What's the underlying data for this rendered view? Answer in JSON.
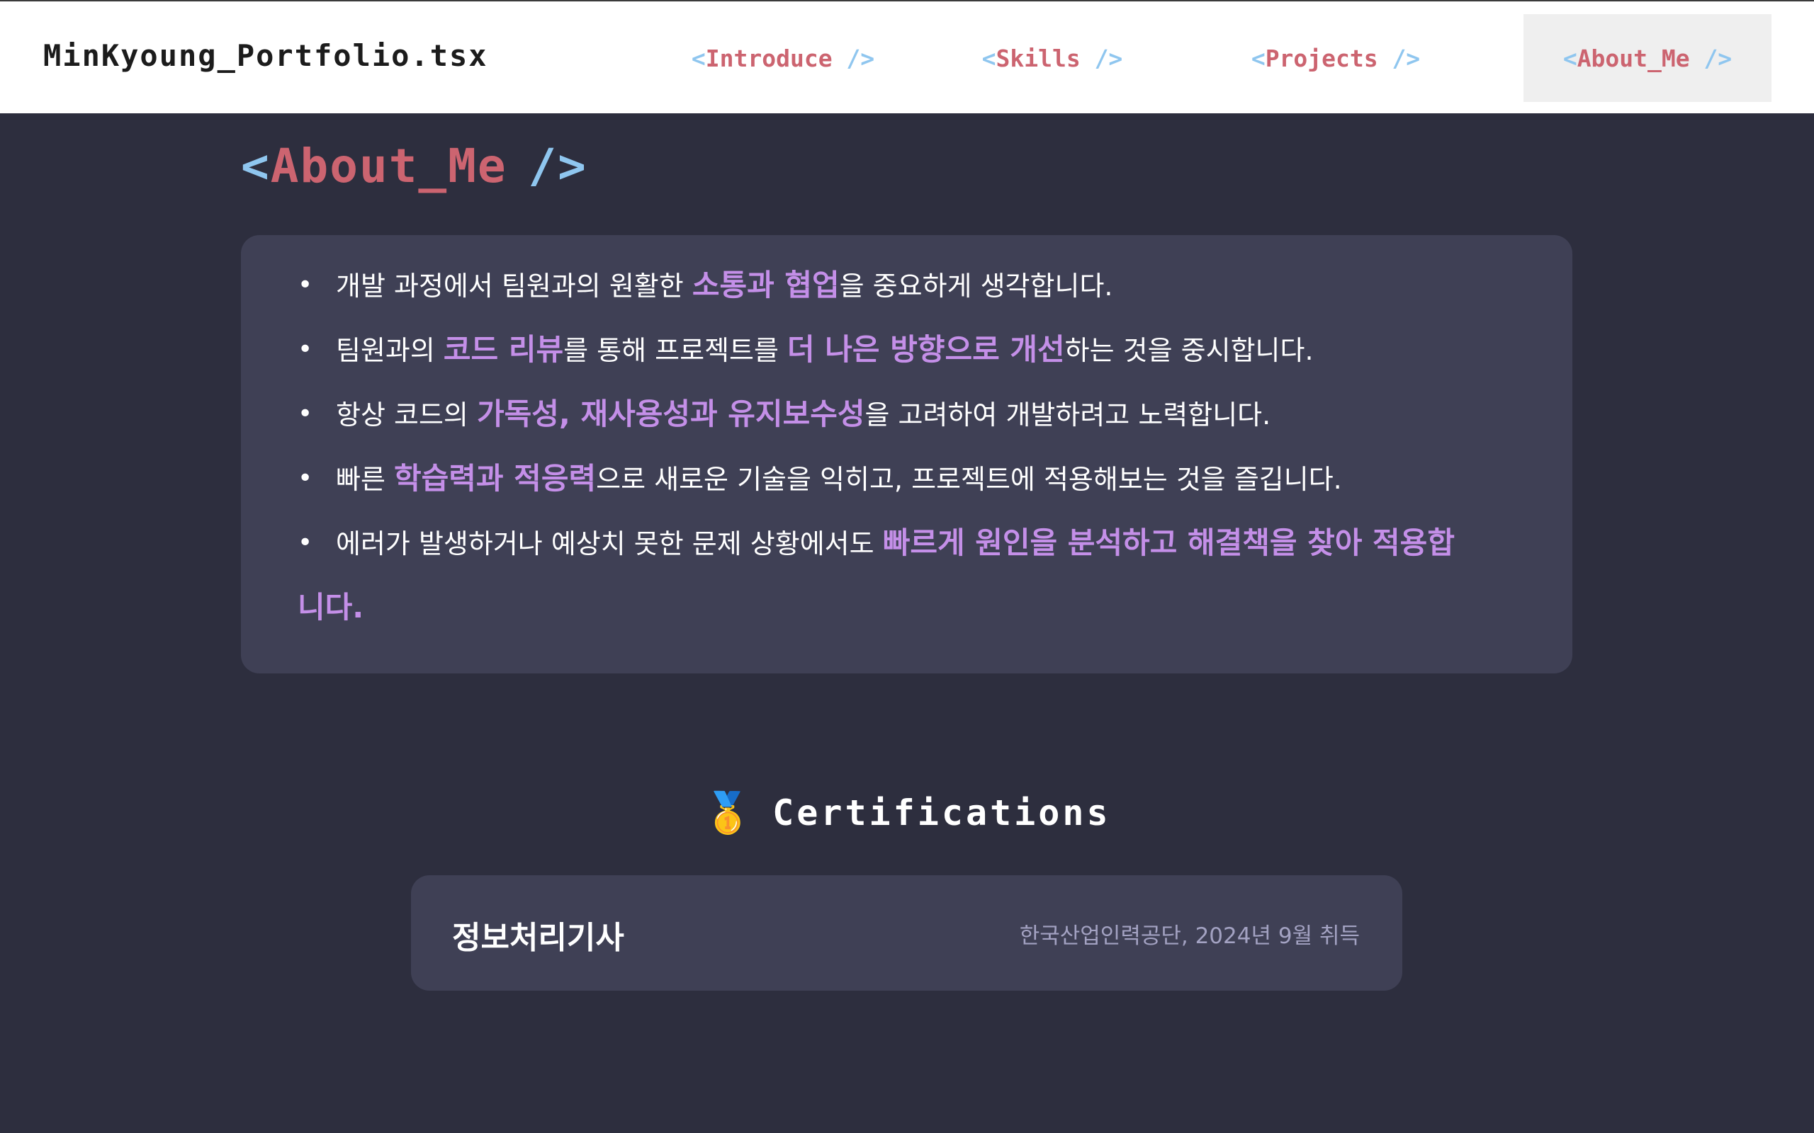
{
  "header": {
    "brand": "MinKyoung_Portfolio.tsx",
    "nav": [
      {
        "lt": "<",
        "name": "Introduce",
        "slash": "/>"
      },
      {
        "lt": "<",
        "name": "Skills",
        "slash": "/>"
      },
      {
        "lt": "<",
        "name": "Projects",
        "slash": "/>"
      },
      {
        "lt": "<",
        "name": "About_Me",
        "slash": "/>",
        "active": true
      }
    ]
  },
  "section": {
    "lt": "<",
    "name": "About_Me",
    "slash": "/>"
  },
  "about": {
    "bullet": "•",
    "items": [
      {
        "pre": "개발 과정에서 팀원과의 원활한 ",
        "hl": "소통과 협업",
        "post": "을 중요하게 생각합니다."
      },
      {
        "pre": "팀원과의 ",
        "hl": "코드 리뷰",
        "mid": "를 통해 프로젝트를 ",
        "hl2": "더 나은 방향으로 개선",
        "post": "하는 것을 중시합니다."
      },
      {
        "pre": "항상 코드의 ",
        "hl": "가독성, 재사용성과 유지보수성",
        "post": "을 고려하여 개발하려고 노력합니다."
      },
      {
        "pre": "빠른 ",
        "hl": "학습력과 적응력",
        "post": "으로 새로운 기술을 익히고, 프로젝트에 적용해보는 것을 즐깁니다."
      },
      {
        "pre": "에러가 발생하거나 예상치 못한 문제 상황에서도 ",
        "hl": "빠르게 원인을 분석하고 해결책을 찾아 적용합",
        "hl_cont": "니다."
      }
    ]
  },
  "certifications": {
    "icon": "medal-icon",
    "medal_glyph": "🥇",
    "title": "Certifications",
    "items": [
      {
        "name": "정보처리기사",
        "meta": "한국산업인력공단, 2024년 9월 취득"
      }
    ]
  },
  "colors": {
    "background": "#2d2e3e",
    "card": "#3f4055",
    "accent_purple": "#c48fe8",
    "tag_red": "#cc6470",
    "tag_blue": "#8fc6ef"
  }
}
